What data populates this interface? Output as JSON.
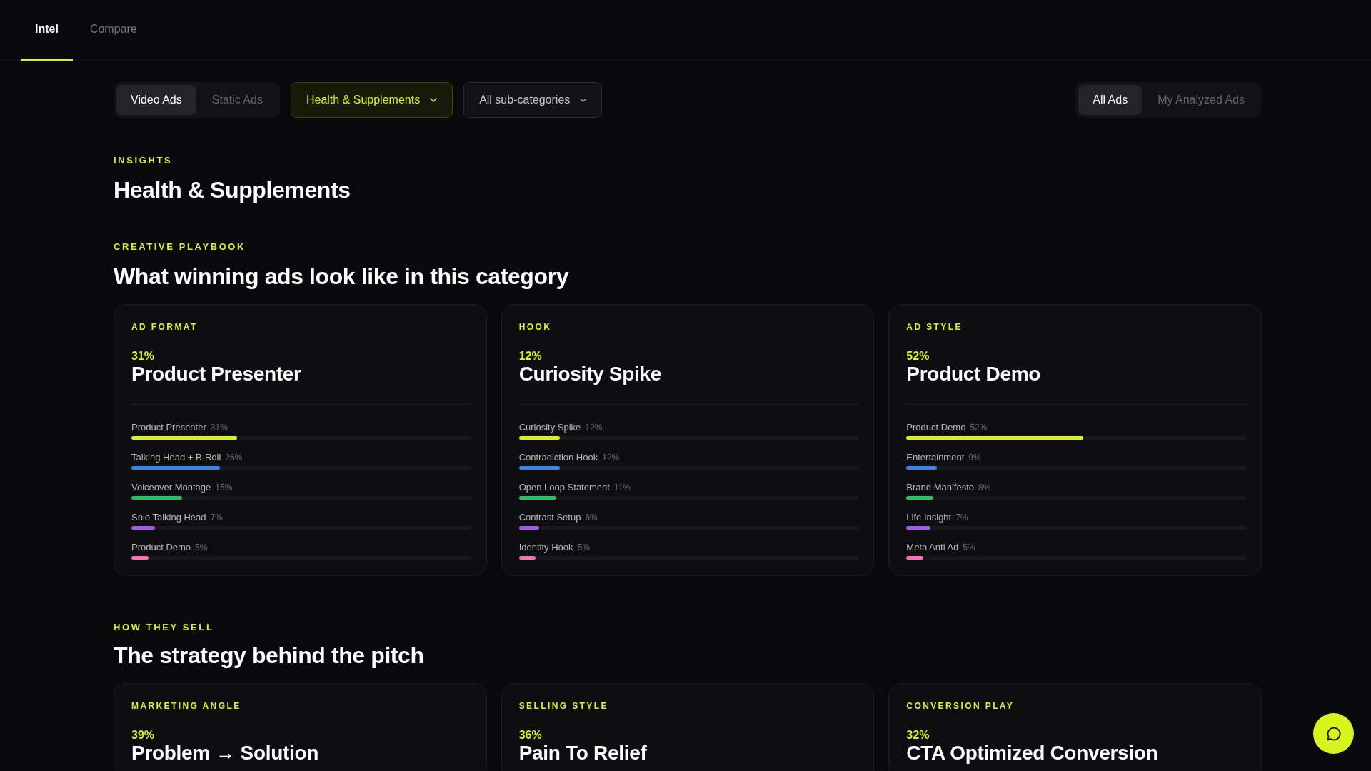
{
  "nav": {
    "tabs": [
      {
        "label": "Intel",
        "selected": true
      },
      {
        "label": "Compare",
        "selected": false
      }
    ]
  },
  "filters": {
    "ad_type": [
      {
        "label": "Video Ads",
        "selected": true
      },
      {
        "label": "Static Ads",
        "selected": false
      }
    ],
    "category": {
      "value": "Health & Supplements",
      "active": true
    },
    "subcategory": {
      "value": "All sub-categories",
      "active": false
    },
    "scope": [
      {
        "label": "All Ads",
        "selected": true
      },
      {
        "label": "My Analyzed Ads",
        "selected": false
      }
    ]
  },
  "insights": {
    "eyebrow": "INSIGHTS",
    "title": "Health & Supplements"
  },
  "sections": [
    {
      "eyebrow": "CREATIVE PLAYBOOK",
      "title": "What winning ads look like in this category",
      "cards": [
        {
          "label": "AD FORMAT",
          "share": "31%",
          "top": "Product Presenter",
          "rows": [
            {
              "name": "Product Presenter",
              "reading": "31%",
              "level": 0.31,
              "color": "#d7f41d"
            },
            {
              "name": "Talking Head + B-Roll",
              "reading": "26%",
              "level": 0.26,
              "color": "#3b82f6"
            },
            {
              "name": "Voiceover Montage",
              "reading": "15%",
              "level": 0.15,
              "color": "#22c55e"
            },
            {
              "name": "Solo Talking Head",
              "reading": "7%",
              "level": 0.07,
              "color": "#a855f7"
            },
            {
              "name": "Product Demo",
              "reading": "5%",
              "level": 0.05,
              "color": "#f472b6"
            }
          ]
        },
        {
          "label": "HOOK",
          "share": "12%",
          "top": "Curiosity Spike",
          "rows": [
            {
              "name": "Curiosity Spike",
              "reading": "12%",
              "level": 0.12,
              "color": "#d7f41d"
            },
            {
              "name": "Contradiction Hook",
              "reading": "12%",
              "level": 0.12,
              "color": "#3b82f6"
            },
            {
              "name": "Open Loop Statement",
              "reading": "11%",
              "level": 0.11,
              "color": "#22c55e"
            },
            {
              "name": "Contrast Setup",
              "reading": "6%",
              "level": 0.06,
              "color": "#a855f7"
            },
            {
              "name": "Identity Hook",
              "reading": "5%",
              "level": 0.05,
              "color": "#f472b6"
            }
          ]
        },
        {
          "label": "AD STYLE",
          "share": "52%",
          "top": "Product Demo",
          "rows": [
            {
              "name": "Product Demo",
              "reading": "52%",
              "level": 0.52,
              "color": "#d7f41d"
            },
            {
              "name": "Entertainment",
              "reading": "9%",
              "level": 0.09,
              "color": "#3b82f6"
            },
            {
              "name": "Brand Manifesto",
              "reading": "8%",
              "level": 0.08,
              "color": "#22c55e"
            },
            {
              "name": "Life Insight",
              "reading": "7%",
              "level": 0.07,
              "color": "#a855f7"
            },
            {
              "name": "Meta Anti Ad",
              "reading": "5%",
              "level": 0.05,
              "color": "#f472b6"
            }
          ]
        }
      ]
    },
    {
      "eyebrow": "HOW THEY SELL",
      "title": "The strategy behind the pitch",
      "cards": [
        {
          "label": "MARKETING ANGLE",
          "share": "39%",
          "top": "Problem → Solution"
        },
        {
          "label": "SELLING STYLE",
          "share": "36%",
          "top": "Pain To Relief"
        },
        {
          "label": "CONVERSION PLAY",
          "share": "32%",
          "top": "CTA Optimized Conversion"
        }
      ]
    }
  ]
}
